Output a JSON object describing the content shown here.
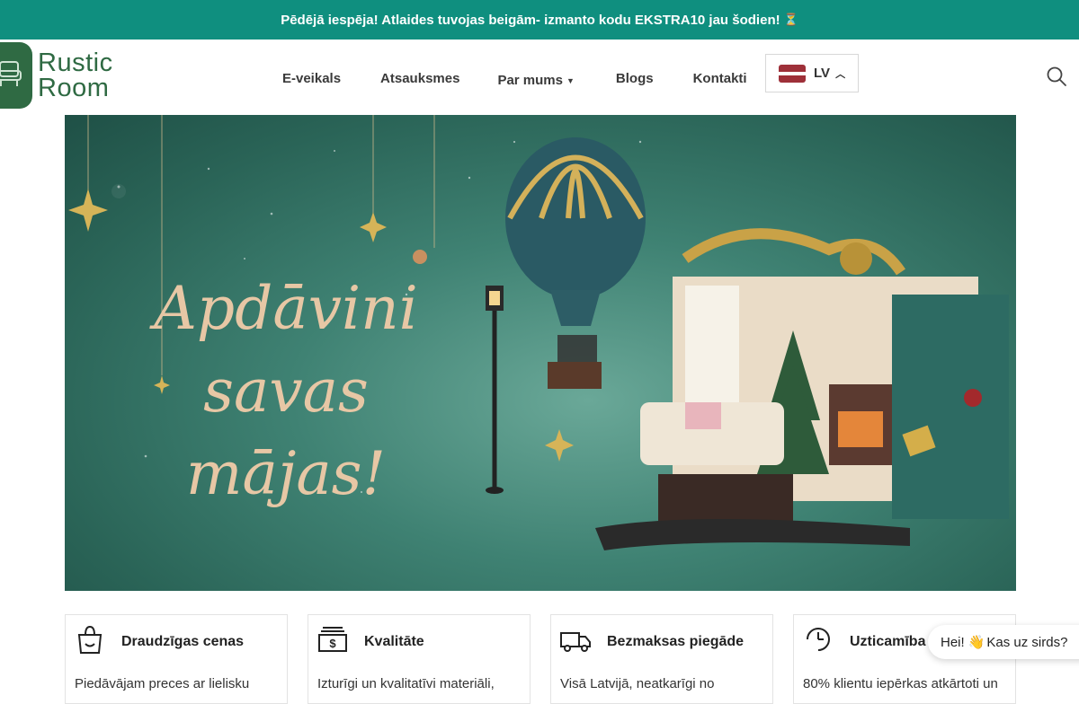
{
  "announcement": {
    "text": "Pēdējā iespēja! Atlaides tuvojas beigām- izmanto kodu EKSTRA10 jau šodien!",
    "icon": "hourglass-icon"
  },
  "logo": {
    "line1": "Rustic",
    "line2": "Room",
    "color": "#2f6a43"
  },
  "nav": {
    "items": [
      {
        "label": "E-veikals"
      },
      {
        "label": "Atsauksmes"
      },
      {
        "label": "Par mums"
      },
      {
        "label": "Blogs"
      },
      {
        "label": "Kontakti"
      }
    ]
  },
  "language": {
    "code": "LV"
  },
  "hero": {
    "line1": "Apdāvini",
    "line2": "savas mājas!"
  },
  "features": [
    {
      "title": "Draudzīgas cenas",
      "desc": "Piedāvājam preces ar lielisku",
      "icon": "shopping-bag-icon"
    },
    {
      "title": "Kvalitāte",
      "desc": "Izturīgi un kvalitatīvi materiāli,",
      "icon": "cash-icon"
    },
    {
      "title": "Bezmaksas piegāde",
      "desc": "Visā Latvijā, neatkarīgi no",
      "icon": "delivery-truck-icon"
    },
    {
      "title": "Uzticamība",
      "desc": "80% klientu iepērkas atkārtoti un",
      "icon": "clock-icon"
    }
  ],
  "chat": {
    "text_before": "Hei!",
    "text_after": "Kas uz sirds?"
  },
  "colors": {
    "accent": "#0f8f7f",
    "brand": "#2f6a43",
    "hero_bg": "#3f8273",
    "hero_text": "#e7c7a5"
  }
}
